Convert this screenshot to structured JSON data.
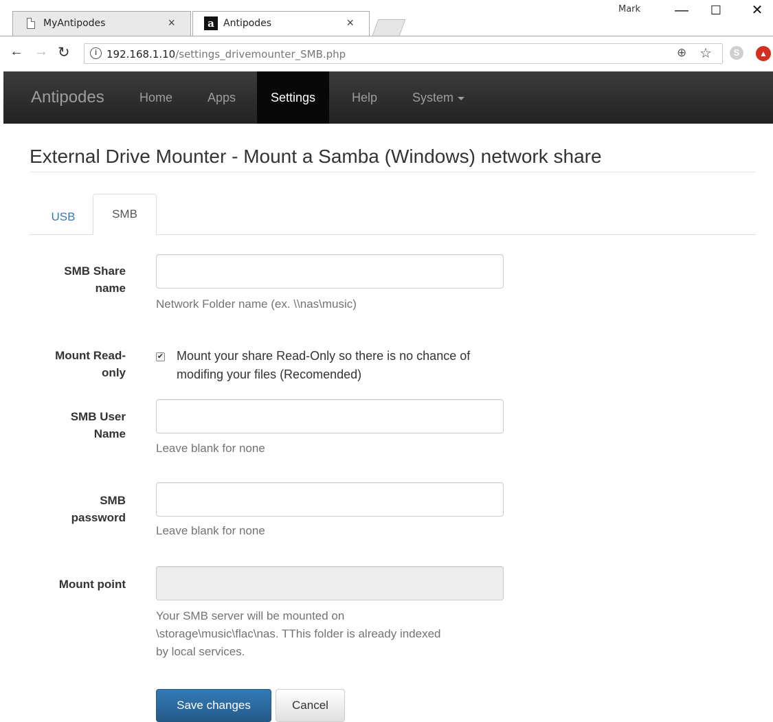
{
  "browser": {
    "tabs": [
      {
        "title": "MyAntipodes",
        "icon": "page-icon"
      },
      {
        "title": "Antipodes",
        "icon": "antipodes-logo-icon"
      }
    ],
    "profile_name": "Mark",
    "address": {
      "host": "192.168.1.10",
      "path": "/settings_drivemounter_SMB.php"
    },
    "info_glyph": "i",
    "extension_skype_glyph": "S",
    "extension_red_glyph": "▲"
  },
  "navbar": {
    "brand": "Antipodes",
    "items": [
      {
        "label": "Home"
      },
      {
        "label": "Apps"
      },
      {
        "label": "Settings"
      },
      {
        "label": "Help"
      },
      {
        "label": "System"
      }
    ],
    "active_item": "Settings"
  },
  "page": {
    "title": "External Drive Mounter - Mount a Samba (Windows) network share",
    "tabs": [
      {
        "label": "USB"
      },
      {
        "label": "SMB"
      }
    ],
    "active_tab": "SMB"
  },
  "form": {
    "share_name": {
      "label_line1": "SMB Share",
      "label_line2": "name",
      "value": "",
      "help": "Network Folder name (ex. \\\\nas\\music)"
    },
    "read_only": {
      "label_line1": "Mount Read-",
      "label_line2": "only",
      "checked": true,
      "text": "Mount your share Read-Only so there is no chance of modifing your files (Recomended)"
    },
    "user_name": {
      "label_line1": "SMB User",
      "label_line2": "Name",
      "value": "",
      "help": "Leave blank for none"
    },
    "password": {
      "label_line1": "SMB",
      "label_line2": "password",
      "value": "",
      "help": "Leave blank for none"
    },
    "mount_point": {
      "label": "Mount point",
      "value": "",
      "help_line1": "Your SMB server will be mounted on",
      "help_line2": "\\storage\\music\\flac\\nas. TThis folder is already indexed",
      "help_line3": "by local services."
    },
    "save_label": "Save changes",
    "cancel_label": "Cancel"
  },
  "colors": {
    "navbar_bg": "#222222",
    "link": "#337ab7",
    "primary_button": "#337ab7"
  }
}
